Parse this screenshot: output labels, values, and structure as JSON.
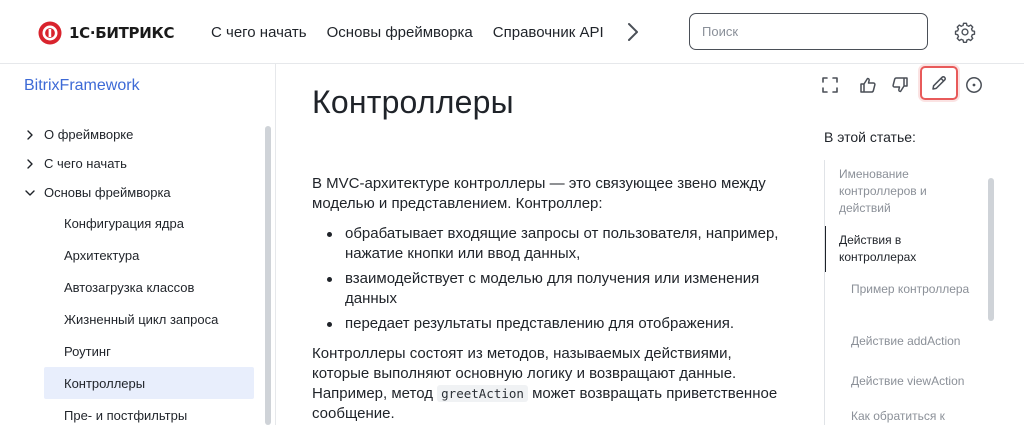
{
  "header": {
    "logo_text": "1С·БИТРИКС",
    "nav": [
      "С чего начать",
      "Основы фреймворка",
      "Справочник API"
    ],
    "search_placeholder": "Поиск"
  },
  "sidebar": {
    "title": "BitrixFramework",
    "items": [
      {
        "label": "О фреймворке",
        "expanded": false
      },
      {
        "label": "С чего начать",
        "expanded": false
      },
      {
        "label": "Основы фреймворка",
        "expanded": true
      }
    ],
    "subitems": [
      "Конфигурация ядра",
      "Архитектура",
      "Автозагрузка классов",
      "Жизненный цикл запроса",
      "Роутинг",
      "Контроллеры",
      "Пре- и постфильтры"
    ],
    "active_subitem": "Контроллеры"
  },
  "article": {
    "title": "Контроллеры",
    "intro": "В MVC-архитектуре контроллеры — это связующее звено между моделью и представлением. Контроллер:",
    "bullets": [
      "обрабатывает входящие запросы от пользователя, например, нажатие кнопки или ввод данных,",
      "взаимодействует с моделью для получения или изменения данных",
      "передает результаты представлению для отображения."
    ],
    "para2_before": "Контроллеры состоят из методов, называемых действиями, которые выполняют основную логику и возвращают данные. Например, метод ",
    "para2_code": "greetAction",
    "para2_after": " может возвращать приветственное сообщение."
  },
  "toc": {
    "title": "В этой статье:",
    "items": [
      {
        "label": "Именование контроллеров и действий",
        "level": 1
      },
      {
        "label": "Действия в контроллерах",
        "level": 1,
        "active": true
      },
      {
        "label": "Пример контроллера",
        "level": 2
      },
      {
        "label": "Действие addAction",
        "level": 2
      },
      {
        "label": "Действие viewAction",
        "level": 2
      },
      {
        "label": "Как обратиться к",
        "level": 2
      }
    ]
  },
  "colors": {
    "accent": "#3d6ad6",
    "active_bg": "#e8eefc",
    "edit_highlight": "#e85a5a",
    "logo_red": "#d9232d"
  },
  "icons": {
    "toolbar": [
      "fullscreen-icon",
      "thumbs-up-icon",
      "thumbs-down-icon",
      "pencil-icon",
      "info-icon"
    ],
    "header": [
      "chevron-right-icon",
      "gear-icon"
    ]
  }
}
